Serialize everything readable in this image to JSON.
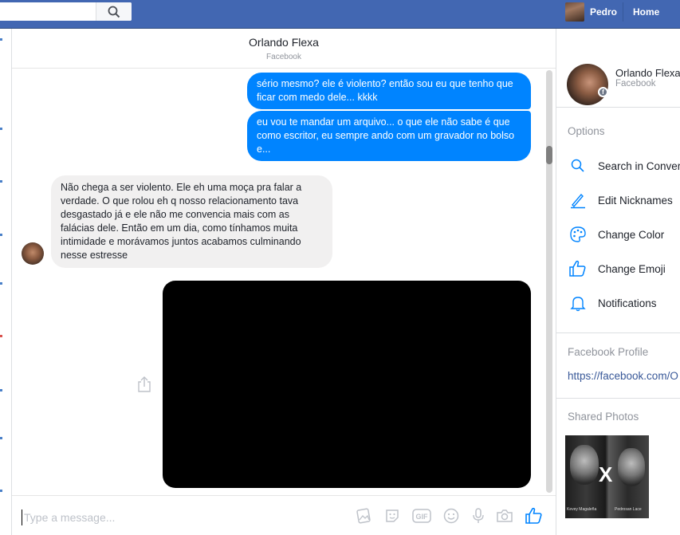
{
  "topbar": {
    "search_placeholder": "",
    "user_name": "Pedro",
    "home_label": "Home"
  },
  "conversation": {
    "contact_name": "Orlando Flexa",
    "contact_source": "Facebook"
  },
  "messages": [
    {
      "direction": "outgoing",
      "text": "sério mesmo? ele é violento? então sou eu que tenho que ficar com medo dele... kkkk"
    },
    {
      "direction": "outgoing",
      "text": "eu vou te mandar um arquivo... o que ele não sabe é que como escritor, eu sempre ando com um gravador no bolso e..."
    },
    {
      "direction": "incoming",
      "text": "Não chega a ser violento. Ele eh uma moça pra falar a verdade. O que rolou eh q nosso relacionamento tava desgastado já e ele não me convencia mais com as falácias dele. Então em um dia, como tínhamos muita intimidade e morávamos juntos acabamos culminando nesse estresse"
    }
  ],
  "composer": {
    "placeholder": "Type a message..."
  },
  "right_panel": {
    "name": "Orlando Flexa",
    "source": "Facebook",
    "badge": "f",
    "options_title": "Options",
    "options": [
      {
        "label": "Search in Conversation",
        "icon": "search-icon"
      },
      {
        "label": "Edit Nicknames",
        "icon": "pencil-icon"
      },
      {
        "label": "Change Color",
        "icon": "palette-icon"
      },
      {
        "label": "Change Emoji",
        "icon": "thumbs-up-icon"
      },
      {
        "label": "Notifications",
        "icon": "bell-icon"
      }
    ],
    "profile_title": "Facebook Profile",
    "profile_link": "https://facebook.com/O",
    "photos_title": "Shared Photos",
    "photo_text": {
      "x": "X",
      "caption_left": "Kevey Magaleña",
      "caption_right": "Pedrosan Lace"
    }
  },
  "colors": {
    "topbar": "#4267b2",
    "outgoing_bubble": "#0084ff",
    "incoming_bubble": "#f1f0f0",
    "accent": "#0084ff",
    "link": "#385898"
  }
}
